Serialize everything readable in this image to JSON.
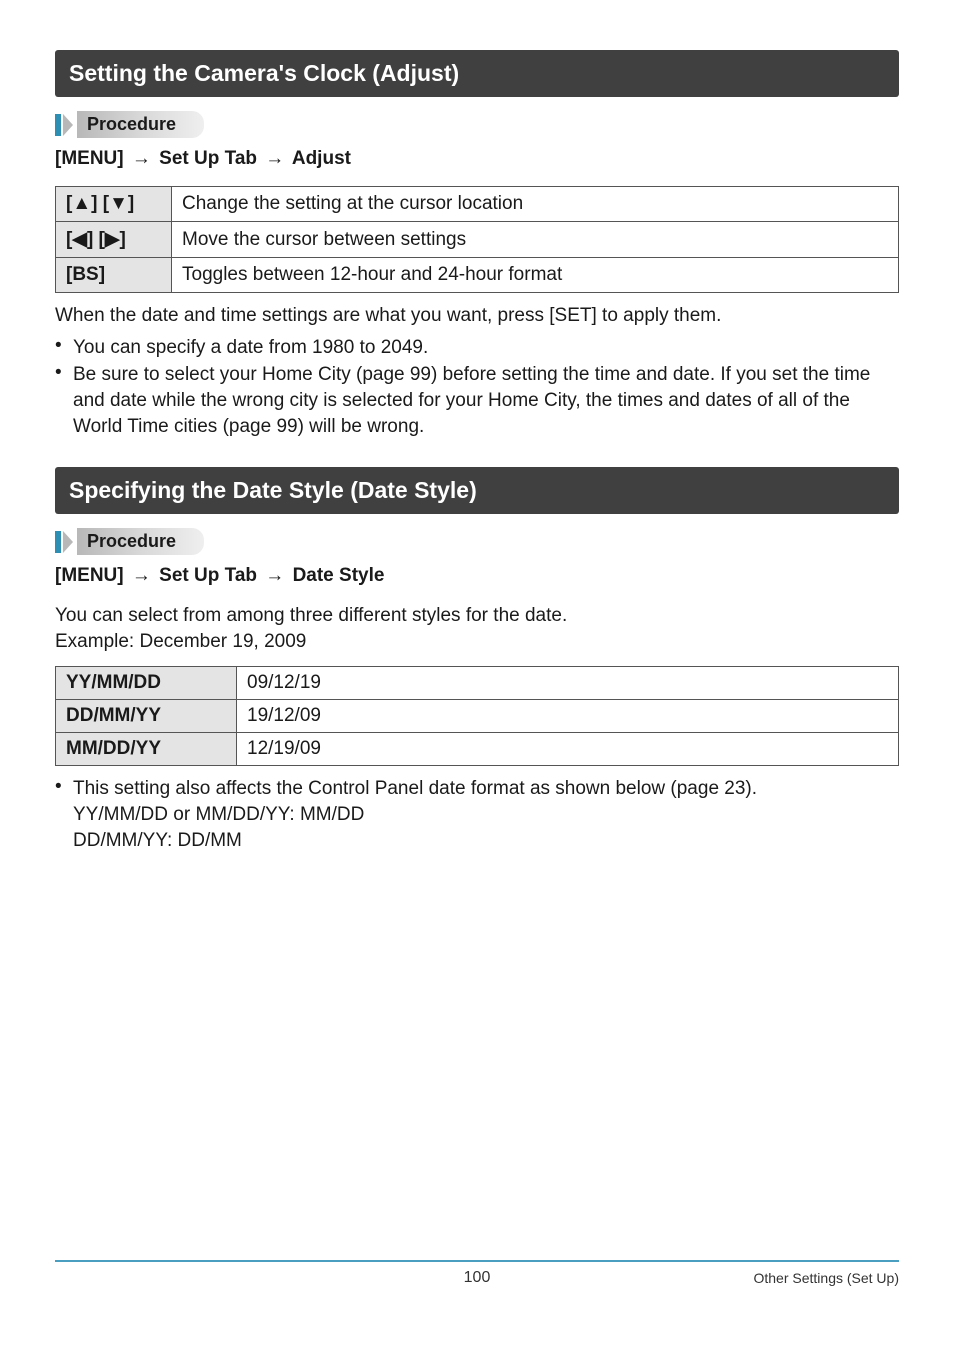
{
  "section1": {
    "title": "Setting the Camera's Clock (Adjust)",
    "procedure_label": "Procedure",
    "menu_path": {
      "a": "[MENU]",
      "b": "Set Up Tab",
      "c": "Adjust",
      "arrow": "→"
    },
    "key_rows": [
      {
        "key": "[▲] [▼]",
        "desc": "Change the setting at the cursor location"
      },
      {
        "key": "[◀] [▶]",
        "desc": "Move the cursor between settings"
      },
      {
        "key": "[BS]",
        "desc": "Toggles between 12-hour and 24-hour format"
      }
    ],
    "after_table": "When the date and time settings are what you want, press [SET] to apply them.",
    "bullets": [
      "You can specify a date from 1980 to 2049.",
      "Be sure to select your Home City (page 99) before setting the time and date. If you set the time and date while the wrong city is selected for your Home City, the times and dates of all of the World Time cities (page 99) will be wrong."
    ]
  },
  "section2": {
    "title": "Specifying the Date Style (Date Style)",
    "procedure_label": "Procedure",
    "menu_path": {
      "a": "[MENU]",
      "b": "Set Up Tab",
      "c": "Date Style",
      "arrow": "→"
    },
    "intro1": "You can select from among three different styles for the date.",
    "intro2": "Example: December 19, 2009",
    "date_rows": [
      {
        "fmt": "YY/MM/DD",
        "val": "09/12/19"
      },
      {
        "fmt": "DD/MM/YY",
        "val": "19/12/09"
      },
      {
        "fmt": "MM/DD/YY",
        "val": "12/19/09"
      }
    ],
    "bullets": [
      "This setting also affects the Control Panel date format as shown below (page 23).\nYY/MM/DD or MM/DD/YY: MM/DD\nDD/MM/YY: DD/MM"
    ]
  },
  "footer": {
    "page": "100",
    "section": "Other Settings (Set Up)"
  }
}
